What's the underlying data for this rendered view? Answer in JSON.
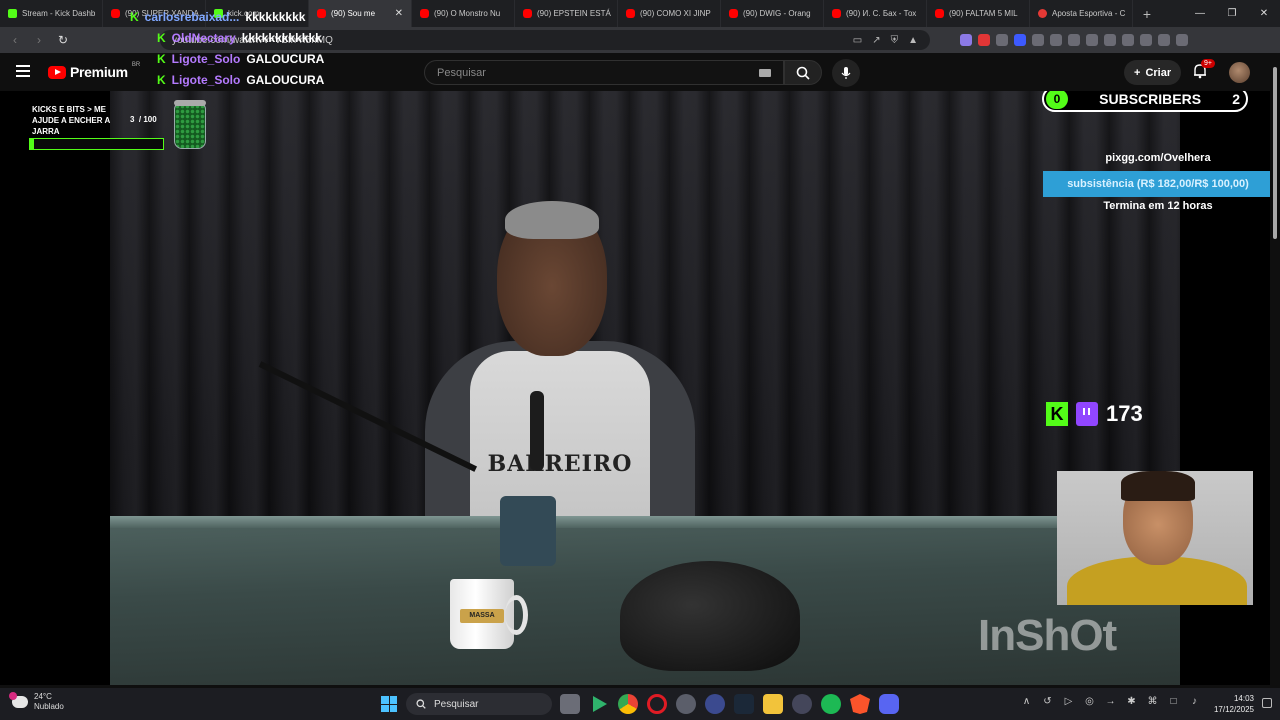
{
  "browser": {
    "tabs": [
      {
        "label": "Stream - Kick Dashb",
        "icon": "kick-icon"
      },
      {
        "label": "(90) SUPER XANDA...",
        "icon": "youtube-icon"
      },
      {
        "label": "kick.com",
        "icon": "kick-icon"
      },
      {
        "label": "(90) Sou me",
        "icon": "youtube-icon",
        "active": true
      },
      {
        "label": "(90) O Monstro Nu",
        "icon": "youtube-icon"
      },
      {
        "label": "(90) EPSTEIN ESTÁ",
        "icon": "youtube-icon"
      },
      {
        "label": "(90) COMO XI JINP",
        "icon": "youtube-icon"
      },
      {
        "label": "(90) DWIG - Orang",
        "icon": "youtube-icon"
      },
      {
        "label": "(90) И. С. Бах - Тох",
        "icon": "youtube-icon"
      },
      {
        "label": "(90) FALTAM 5 MIL",
        "icon": "youtube-icon"
      },
      {
        "label": "Aposta Esportiva - C",
        "icon": "bet-icon"
      }
    ],
    "tab_close": "✕",
    "new_tab": "+",
    "window_controls": {
      "minimize": "—",
      "maximize": "❐",
      "close": "✕"
    },
    "address": "youtube.com/watch?v=VBfh-rf5nMQ"
  },
  "youtube": {
    "logo_text": "Premium",
    "region": "BR",
    "search_placeholder": "Pesquisar",
    "create_label": "Criar",
    "notifications_badge": "9+"
  },
  "overlay": {
    "jar": {
      "label": "KICKS E BITS > ME AJUDE A ENCHER A JARRA",
      "current": "3",
      "total": "/ 100",
      "progress": 0.03
    },
    "subscribers": {
      "left_count": "0",
      "label": "SUBSCRIBERS",
      "right_count": "2"
    },
    "goal": {
      "site": "pixgg.com/Ovelhera",
      "bar_text": "subsistência (R$ 182,00/R$ 100,00)",
      "ends": "Termina em 12 horas"
    },
    "viewers": {
      "count": "173"
    },
    "watermark": "InShOt",
    "shirt_text": "BARREIRO",
    "mug_text": "MASSA",
    "chat": [
      {
        "user": "carlosrebaixad...",
        "msg": "kkkkkkkkk",
        "color": "blue"
      },
      {
        "user": "OldNectary",
        "msg": "kkkkkkkkkkkk",
        "color": "purple"
      },
      {
        "user": "Ligote_Solo",
        "msg": "GALOUCURA",
        "color": "purple"
      },
      {
        "user": "Ligote_Solo",
        "msg": "GALOUCURA",
        "color": "purple"
      }
    ]
  },
  "taskbar": {
    "weather_temp": "24°C",
    "weather_desc": "Nublado",
    "search_label": "Pesquisar",
    "time": "14:03",
    "date": "17/12/2025"
  },
  "colors": {
    "kick_green": "#53fc18",
    "youtube_red": "#ff0000",
    "goal_blue": "#2e9fd6",
    "twitch_purple": "#9146ff"
  }
}
